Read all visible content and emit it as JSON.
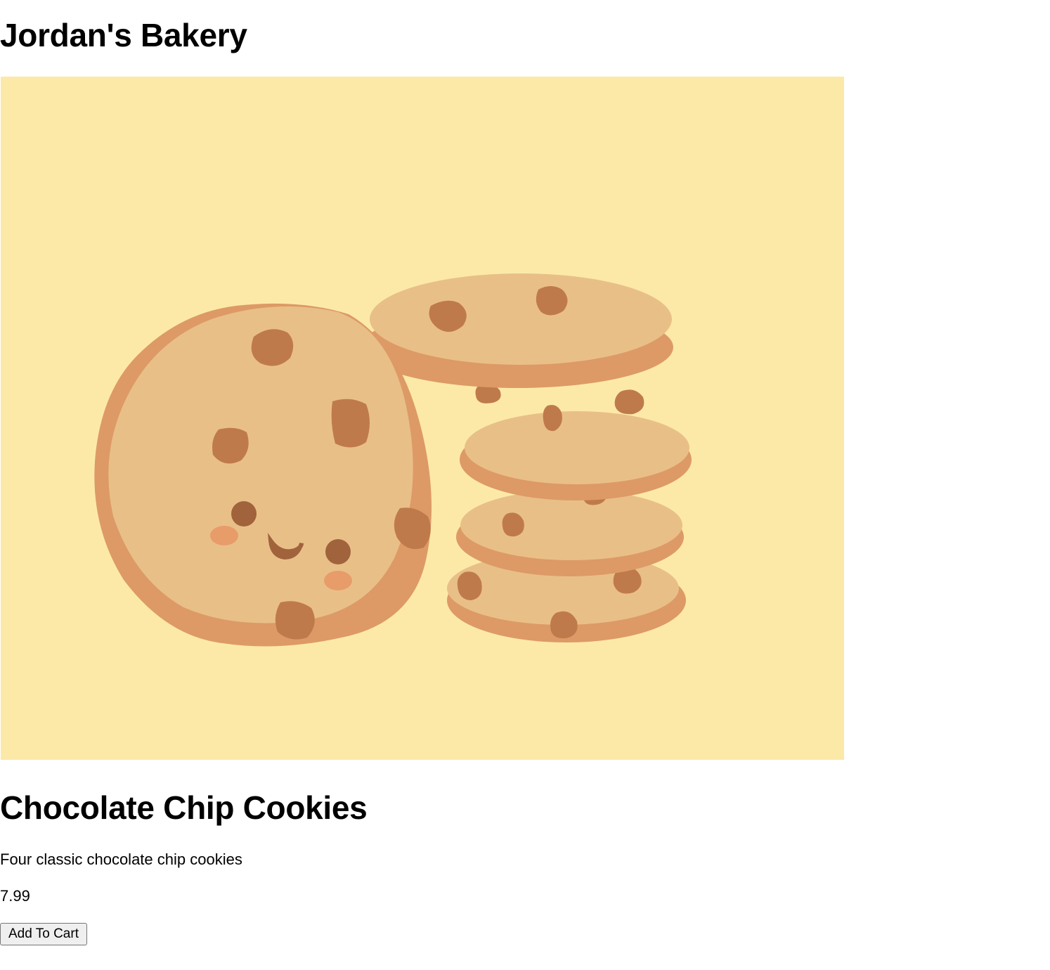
{
  "header": {
    "title": "Jordan's Bakery"
  },
  "product": {
    "image_icon": "cookie-stack-illustration",
    "image_background": "#fce9a8",
    "name": "Chocolate Chip Cookies",
    "description": "Four classic chocolate chip cookies",
    "price": "7.99",
    "add_to_cart_label": "Add To Cart"
  }
}
